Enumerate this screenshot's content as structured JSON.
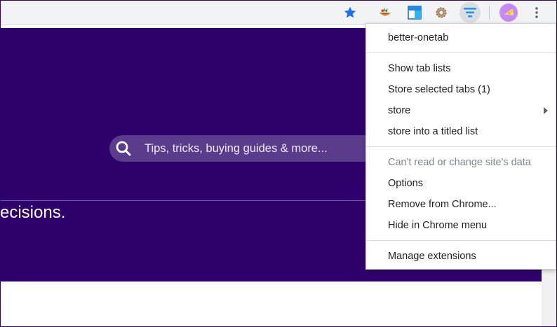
{
  "toolbar": {
    "icons": [
      "star-icon",
      "puzzle-extension-icon",
      "window-extension-icon",
      "gear-extension-icon",
      "onetab-filter-icon",
      "avatar",
      "more-vert-icon"
    ],
    "accent": "#1a73e8"
  },
  "page": {
    "search_placeholder": "Tips, tricks, buying guides & more...",
    "hero_text": "ecisions.",
    "colors": {
      "hero_bg": "#2e006b",
      "search_bg": "#5a3b8c"
    }
  },
  "context_menu": {
    "title": "better-onetab",
    "items_group1": [
      "Show tab lists",
      "Store selected tabs (1)",
      "store",
      "store into a titled list"
    ],
    "disabled_item": "Can't read or change site's data",
    "items_group2": [
      "Options",
      "Remove from Chrome...",
      "Hide in Chrome menu"
    ],
    "footer": "Manage extensions"
  }
}
